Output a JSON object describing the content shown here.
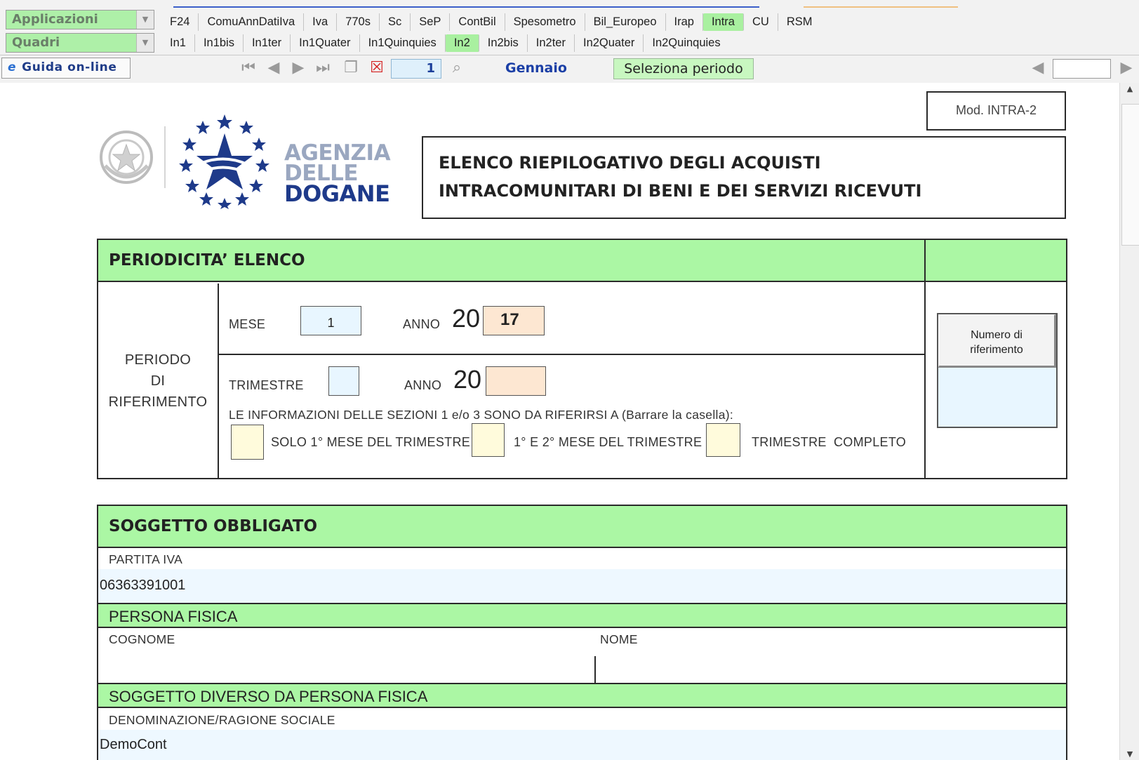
{
  "app": {
    "row1_select": "Applicazioni",
    "row2_select": "Quadri",
    "tabs_row1": [
      "F24",
      "ComuAnnDatiIva",
      "Iva",
      "770s",
      "Sc",
      "SeP",
      "ContBil",
      "Spesometro",
      "Bil_Europeo",
      "Irap",
      "Intra",
      "CU",
      "RSM"
    ],
    "tabs_row1_active": "Intra",
    "tabs_row2": [
      "In1",
      "In1bis",
      "In1ter",
      "In1Quater",
      "In1Quinquies",
      "In2",
      "In2bis",
      "In2ter",
      "In2Quater",
      "In2Quinquies"
    ],
    "tabs_row2_active": "In2"
  },
  "toolbar": {
    "help_label": "Guida on-line",
    "page_number": "1",
    "month": "Gennaio",
    "select_period_label": "Seleziona periodo"
  },
  "header": {
    "agency_line1": "AGENZIA",
    "agency_line2": "DELLE",
    "agency_line3": "DOGANE",
    "model": "Mod. INTRA-2",
    "title_line1": "ELENCO RIEPILOGATIVO DEGLI ACQUISTI",
    "title_line2": "INTRACOMUNITARI DI BENI E DEI SERVIZI RICEVUTI"
  },
  "periodicita": {
    "title": "PERIODICITA’ ELENCO",
    "period_label_1": "PERIODO",
    "period_label_2": "DI",
    "period_label_3": "RIFERIMENTO",
    "mese_label": "MESE",
    "mese_value": "1",
    "anno_label": "ANNO",
    "anno_prefix": "20",
    "anno_value": "17",
    "trimestre_label": "TRIMESTRE",
    "trimestre_value": "",
    "anno2_label": "ANNO",
    "anno2_prefix": "20",
    "anno2_value": "",
    "info_text": "LE INFORMAZIONI DELLE SEZIONI 1 e/o 3 SONO DA RIFERIRSI A (Barrare la casella):",
    "opt1": "SOLO 1° MESE DEL TRIMESTRE",
    "opt2": "1° E 2° MESE DEL TRIMESTRE",
    "opt3": "TRIMESTRE",
    "opt3b": "COMPLETO",
    "ref_button": "Numero di riferimento",
    "ref_value": ""
  },
  "soggetto": {
    "title": "SOGGETTO OBBLIGATO",
    "piva_label": "PARTITA IVA",
    "piva_value": "06363391001",
    "pf_title": "PERSONA FISICA",
    "cognome_label": "COGNOME",
    "cognome_value": "",
    "nome_label": "NOME",
    "nome_value": "",
    "dpf_title": "SOGGETTO DIVERSO DA PERSONA FISICA",
    "denominazione_label": "DENOMINAZIONE/RAGIONE SOCIALE",
    "denominazione_value": "DemoCont"
  },
  "colors": {
    "green_header": "#abf7a4",
    "active_tab": "#a9f0a0",
    "field_blue": "#e8f6ff",
    "field_peach": "#fde7d2",
    "checkbox_yellow": "#fffbdc",
    "agency_blue": "#1e3a8a"
  }
}
